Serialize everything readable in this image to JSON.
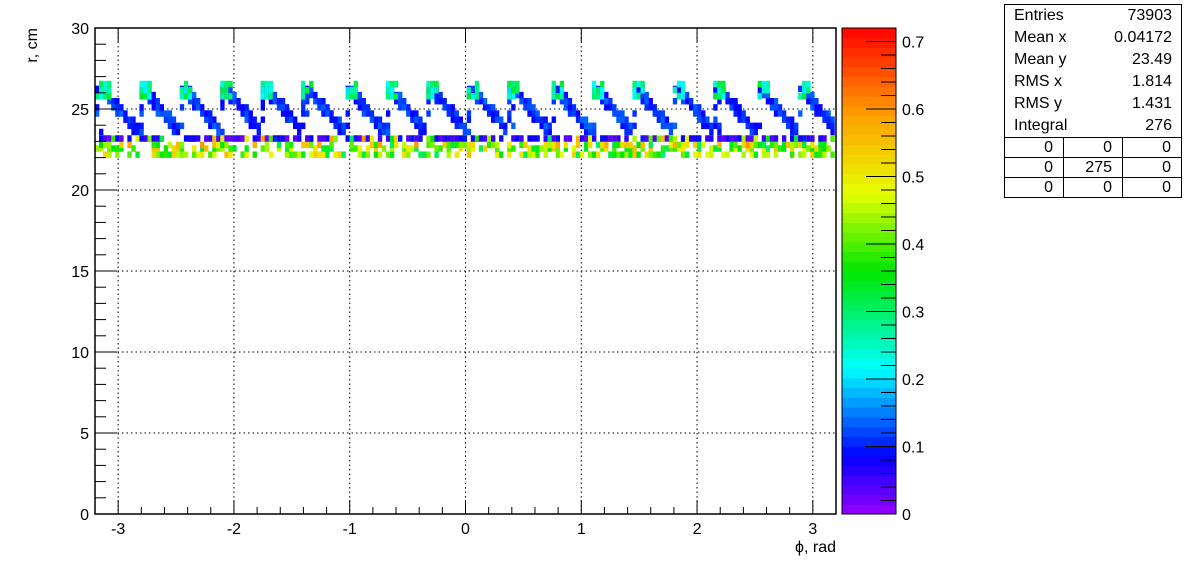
{
  "chart_data": {
    "type": "heatmap",
    "title": "",
    "xlabel": "ϕ, rad",
    "ylabel": "r, cm",
    "xlim": [
      -3.2,
      3.2
    ],
    "ylim": [
      0,
      30
    ],
    "x_ticks": [
      "-3",
      "-2",
      "-1",
      "0",
      "1",
      "2",
      "3"
    ],
    "y_ticks": [
      "0",
      "5",
      "10",
      "15",
      "20",
      "25",
      "30"
    ],
    "grid": true,
    "zlim": [
      0,
      0.72
    ],
    "z_ticks": [
      "0",
      "0.1",
      "0.2",
      "0.3",
      "0.4",
      "0.5",
      "0.6",
      "0.7"
    ],
    "pattern": {
      "repeat_count": 18,
      "bin_width_rad": 0.0349,
      "bands": [
        {
          "r_min": 22.0,
          "r_max": 22.6,
          "z_min": 0.3,
          "z_max": 0.55
        },
        {
          "r_min": 22.6,
          "r_max": 23.4,
          "z_min": 0.3,
          "z_max": 0.6
        },
        {
          "r_min": 23.0,
          "r_max": 23.3,
          "z_min": 0.02,
          "z_max": 0.1
        },
        {
          "r_min": 23.4,
          "r_max": 26.4,
          "z_min": 0.08,
          "z_max": 0.14
        },
        {
          "r_min": 25.6,
          "r_max": 26.8,
          "z_min": 0.2,
          "z_max": 0.34
        }
      ]
    },
    "stats": {
      "rows": [
        {
          "label": "Entries",
          "value": "73903"
        },
        {
          "label": "Mean x",
          "value": "0.04172"
        },
        {
          "label": "Mean y",
          "value": "23.49"
        },
        {
          "label": "RMS x",
          "value": "1.814"
        },
        {
          "label": "RMS y",
          "value": "1.431"
        },
        {
          "label": "Integral",
          "value": "276"
        }
      ],
      "grid": [
        [
          "0",
          "0",
          "0"
        ],
        [
          "0",
          "275",
          "0"
        ],
        [
          "0",
          "0",
          "0"
        ]
      ]
    }
  }
}
